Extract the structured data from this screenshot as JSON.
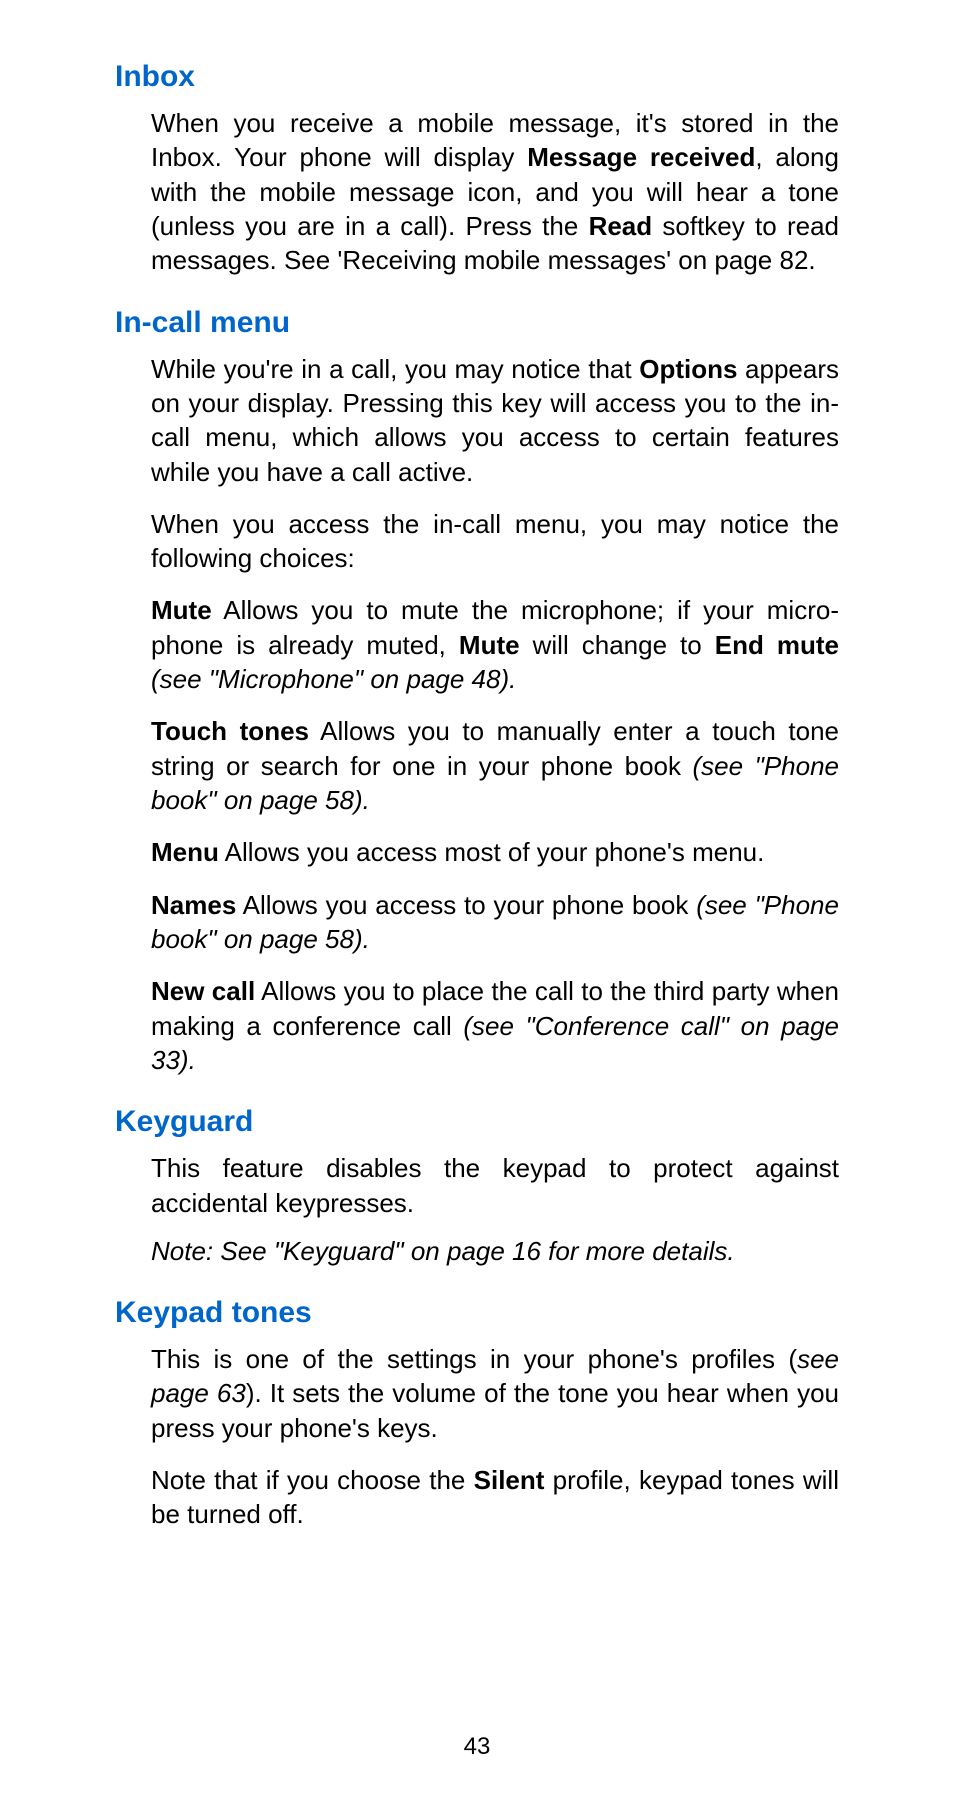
{
  "sections": {
    "inbox": {
      "heading": "Inbox",
      "p1_a": "When you receive a mobile message, it's stored in the Inbox. Your phone will display ",
      "p1_b1": "Message received",
      "p1_c": ", along with the mobile message icon, and you will hear a tone (unless you are in a call). Press the ",
      "p1_b2": "Read",
      "p1_d": " softkey to read messages. See 'Receiving mobile messages' on page 82."
    },
    "incall": {
      "heading": "In-call menu",
      "p1_a": "While you're in a call, you may notice that ",
      "p1_b1": "Options",
      "p1_c": " appears on your display. Pressing this key will access you to the in-call menu, which allows you access to certain features while you have a call active.",
      "p2": "When you access the in-call menu, you may notice the following choices:",
      "mute_b1": "Mute",
      "mute_a": " Allows you to mute the microphone; if your micro­phone is already muted, ",
      "mute_b2": "Mute",
      "mute_c": " will change to ",
      "mute_b3": "End mute",
      "mute_d": " ",
      "mute_i": "(see \"Microphone\" on page 48).",
      "tt_b1": "Touch tones",
      "tt_a": " Allows you to manually enter a touch tone string or search for one in your phone book ",
      "tt_i": "(see \"Phone book\" on page 58).",
      "menu_b1": "Menu",
      "menu_a": " Allows you access most of your phone's menu.",
      "names_b1": "Names",
      "names_a": " Allows you access to your phone book ",
      "names_i": "(see \"Phone book\" on page 58).",
      "nc_b1": "New call",
      "nc_a": " Allows you to place the call to the third party when making a conference call ",
      "nc_i": "(see \"Conference call\" on page 33)."
    },
    "keyguard": {
      "heading": "Keyguard",
      "p1": "This feature disables the keypad to protect against accidental keypresses.",
      "p2": "Note: See \"Keyguard\" on page 16 for more details."
    },
    "keypad": {
      "heading": "Keypad tones",
      "p1_a": "This is one of the settings in your phone's profiles (",
      "p1_i": "see page 63",
      "p1_b": "). It sets the volume of the tone you hear when you press your phone's keys.",
      "p2_a": "Note that if you choose the ",
      "p2_b1": "Silent",
      "p2_c": " profile, keypad tones will be turned off."
    }
  },
  "page_number": "43"
}
